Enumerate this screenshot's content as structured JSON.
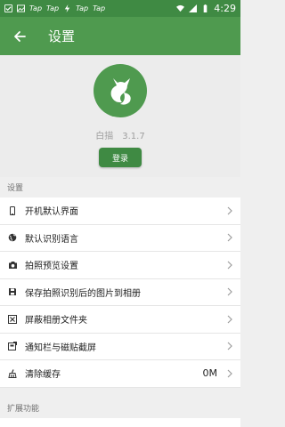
{
  "status_bar": {
    "notifications": [
      "Tap",
      "Tap",
      "Tap",
      "Tap"
    ],
    "time": "4:29"
  },
  "toolbar": {
    "title": "设置",
    "back_icon": "arrow-left-icon"
  },
  "app_info": {
    "name": "白描",
    "version": "3.1.7",
    "login_label": "登录",
    "logo_icon": "cat-logo-icon"
  },
  "sections": {
    "settings_title": "设置",
    "extension_title": "扩展功能"
  },
  "settings_items": [
    {
      "label": "开机默认界面",
      "icon": "phone-icon",
      "value": ""
    },
    {
      "label": "默认识别语言",
      "icon": "globe-icon",
      "value": ""
    },
    {
      "label": "拍照预览设置",
      "icon": "camera-icon",
      "value": ""
    },
    {
      "label": "保存拍照识别后的图片到相册",
      "icon": "save-icon",
      "value": ""
    },
    {
      "label": "屏蔽相册文件夹",
      "icon": "block-folder-icon",
      "value": ""
    },
    {
      "label": "通知栏与磁贴截屏",
      "icon": "screenshot-icon",
      "value": ""
    },
    {
      "label": "清除缓存",
      "icon": "broom-icon",
      "value": "0M"
    }
  ],
  "colors": {
    "status_bar": "#3f8a43",
    "toolbar": "#4f9a4f",
    "accent": "#3f8a43"
  }
}
